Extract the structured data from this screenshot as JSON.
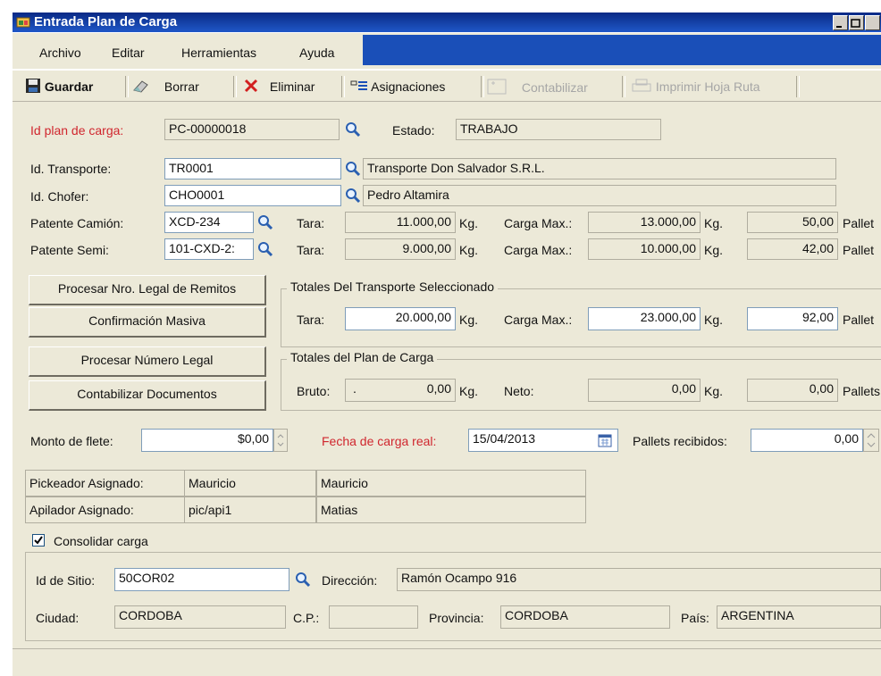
{
  "window": {
    "title": "Entrada Plan de Carga"
  },
  "menu": [
    "Archivo",
    "Editar",
    "Herramientas",
    "Ayuda"
  ],
  "toolbar": {
    "guardar": "Guardar",
    "borrar": "Borrar",
    "eliminar": "Eliminar",
    "asignaciones": "Asignaciones",
    "contabilizar": "Contabilizar",
    "imprimir": "Imprimir Hoja Ruta"
  },
  "header": {
    "id_plan_label": "Id plan de carga:",
    "id_plan_value": "PC-00000018",
    "estado_label": "Estado:",
    "estado_value": "TRABAJO"
  },
  "transporte": {
    "id_transporte_label": "Id. Transporte:",
    "id_transporte_value": "TR0001",
    "transporte_name": "Transporte Don Salvador S.R.L.",
    "id_chofer_label": "Id. Chofer:",
    "id_chofer_value": "CHO0001",
    "chofer_name": "Pedro Altamira"
  },
  "camion": {
    "label": "Patente Camión:",
    "value": "XCD-234",
    "tara_label": "Tara:",
    "tara": "11.000,00",
    "unit": "Kg.",
    "max_label": "Carga Max.:",
    "max": "13.000,00",
    "max_unit": "Kg.",
    "pallets": "50,00",
    "pallets_label": "Pallet"
  },
  "semi": {
    "label": "Patente Semi:",
    "value": "101-CXD-2:",
    "tara_label": "Tara:",
    "tara": "9.000,00",
    "unit": "Kg.",
    "max_label": "Carga Max.:",
    "max": "10.000,00",
    "max_unit": "Kg.",
    "pallets": "42,00",
    "pallets_label": "Pallet"
  },
  "actions": [
    "Procesar Nro. Legal de Remitos",
    "Confirmación Masiva",
    "Procesar Número Legal",
    "Contabilizar Documentos"
  ],
  "totales_transporte": {
    "title": "Totales Del Transporte Seleccionado",
    "tara_label": "Tara:",
    "tara": "20.000,00",
    "unit": "Kg.",
    "max_label": "Carga Max.:",
    "max": "23.000,00",
    "max_unit": "Kg.",
    "pallets": "92,00",
    "pallets_label": "Pallet"
  },
  "totales_plan": {
    "title": "Totales del  Plan de Carga",
    "bruto_label": "Bruto:",
    "bruto_dot": ".",
    "bruto": "0,00",
    "unit": "Kg.",
    "neto_label": "Neto:",
    "neto": "0,00",
    "neto_unit": "Kg.",
    "pallets": "0,00",
    "pallets_label": "Pallets"
  },
  "flete": {
    "monto_label": "Monto de flete:",
    "monto": "$0,00",
    "fecha_label": "Fecha de carga real:",
    "fecha": "15/04/2013",
    "pallets_label": "Pallets recibidos:",
    "pallets": "0,00"
  },
  "asignados": {
    "pickeador_label": "Pickeador Asignado:",
    "pickeador_id": "Mauricio",
    "pickeador_name": "Mauricio",
    "apilador_label": "Apilador Asignado:",
    "apilador_id": "pic/api1",
    "apilador_name": "Matias"
  },
  "consolidar": {
    "label": "Consolidar carga",
    "checked": true
  },
  "sitio": {
    "id_label": "Id de Sitio:",
    "id_value": "50COR02",
    "direccion_label": "Dirección:",
    "direccion": "Ramón Ocampo 916",
    "ciudad_label": "Ciudad:",
    "ciudad": "CORDOBA",
    "cp_label": "C.P.:",
    "cp": "",
    "provincia_label": "Provincia:",
    "provincia": "CORDOBA",
    "pais_label": "País:",
    "pais": "ARGENTINA"
  },
  "colors": {
    "title_bar": "#1f57c8",
    "required_label": "#d0262e",
    "form_bg": "#ece9d8"
  }
}
